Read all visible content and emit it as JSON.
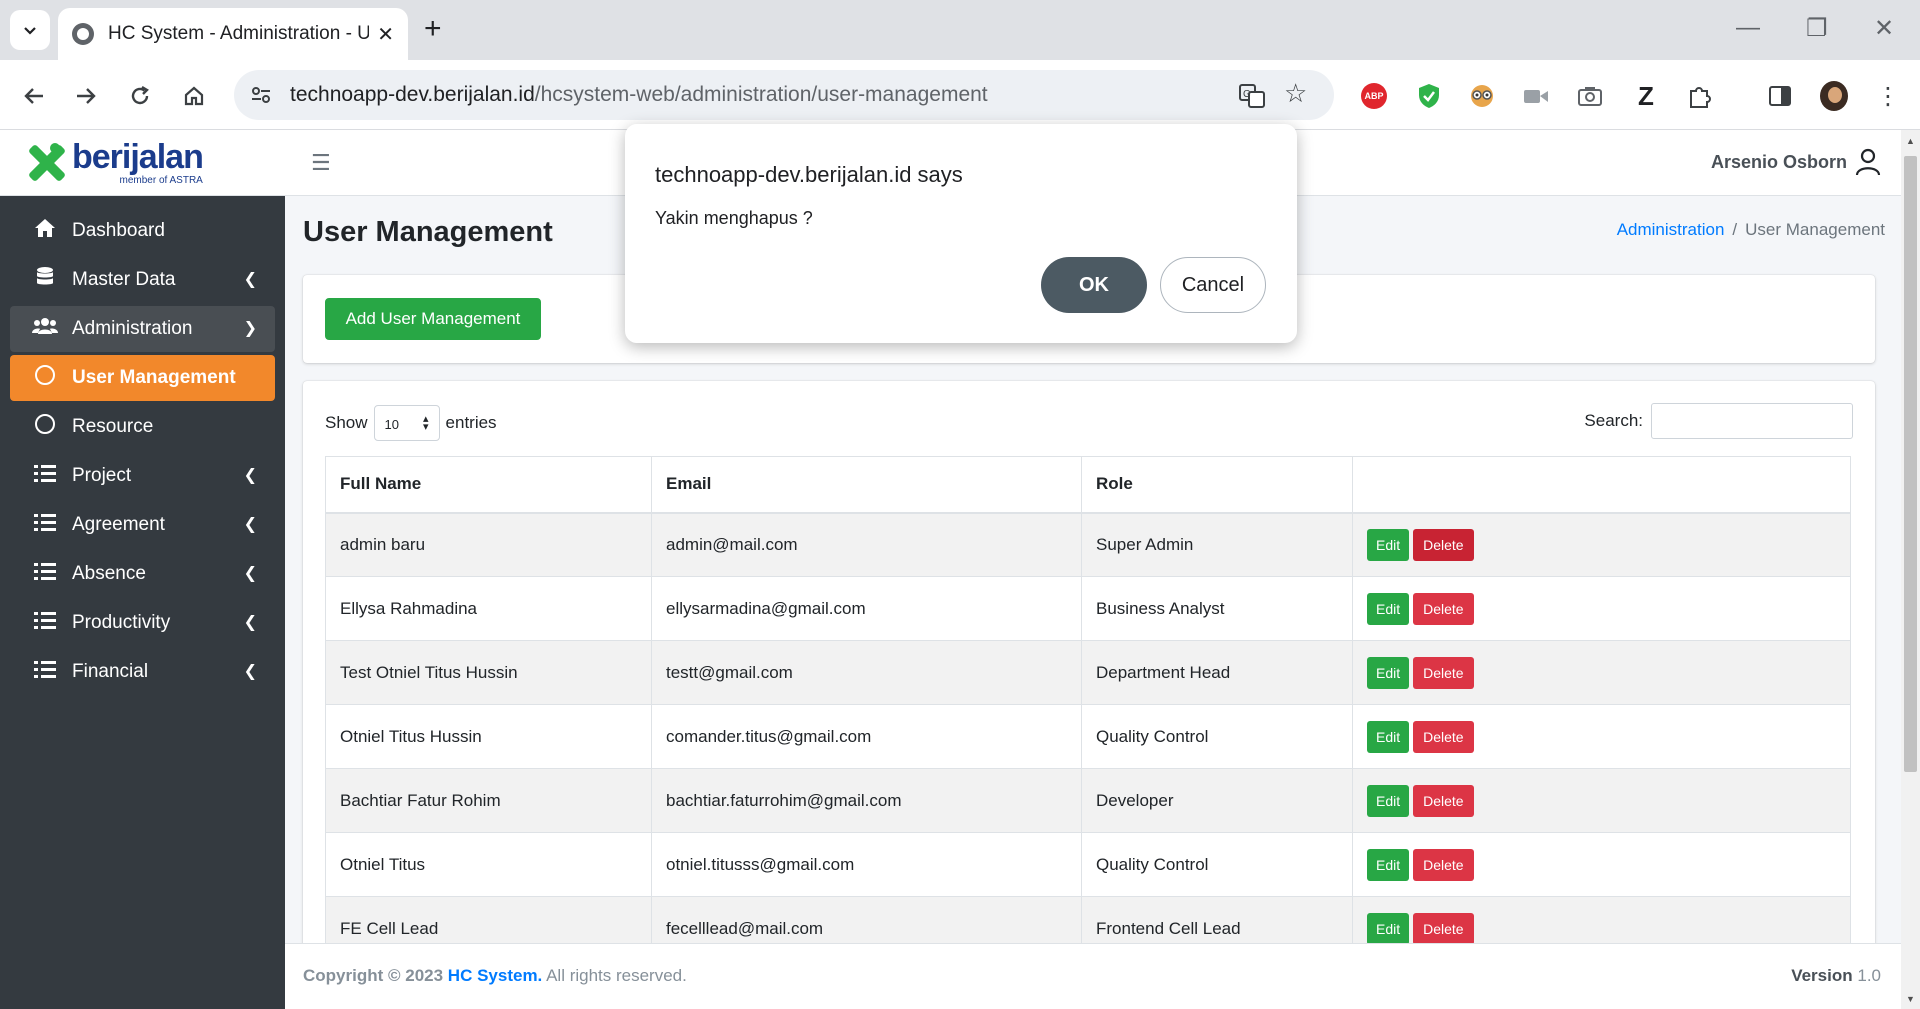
{
  "browser": {
    "tab_title": "HC System - Administration - U",
    "url_host": "technoapp-dev.berijalan.id",
    "url_path": "/hcsystem-web/administration/user-management",
    "abp_label": "ABP",
    "ext_z_label": "Z",
    "icons": [
      "tab-search-icon",
      "globe-icon",
      "close-icon",
      "plus-icon",
      "minimize-icon",
      "restore-icon",
      "back-icon",
      "forward-icon",
      "reload-icon",
      "home-icon",
      "site-info-icon",
      "translate-icon",
      "star-icon",
      "shield-icon",
      "eyes-icon",
      "video-icon",
      "camera-icon",
      "puzzle-icon",
      "sidepanel-icon",
      "menu-dots-icon"
    ]
  },
  "brand": {
    "name": "berijalan",
    "subtitle": "member of ASTRA",
    "color": "#1b3c8c",
    "mark_color": "#2fb34a"
  },
  "sidebar": {
    "items": [
      {
        "label": "Dashboard",
        "icon": "home-icon"
      },
      {
        "label": "Master Data",
        "icon": "database-icon"
      },
      {
        "label": "Administration",
        "icon": "users-icon"
      },
      {
        "label": "User Management",
        "icon": "circle-icon"
      },
      {
        "label": "Resource",
        "icon": "circle-icon"
      },
      {
        "label": "Project",
        "icon": "list-icon"
      },
      {
        "label": "Agreement",
        "icon": "list-icon"
      },
      {
        "label": "Absence",
        "icon": "list-icon"
      },
      {
        "label": "Productivity",
        "icon": "list-icon"
      },
      {
        "label": "Financial",
        "icon": "list-icon"
      }
    ],
    "active_color": "#f2882b"
  },
  "header": {
    "user_name": "Arsenio Osborn"
  },
  "page": {
    "title": "User Management",
    "breadcrumb": {
      "parent": "Administration",
      "current": "User Management",
      "separator": "/"
    },
    "add_button": "Add User Management"
  },
  "table": {
    "show_label": "Show",
    "entries_value": "10",
    "entries_label": "entries",
    "search_label": "Search:",
    "columns": [
      "Full Name",
      "Email",
      "Role",
      ""
    ],
    "edit_label": "Edit",
    "delete_label": "Delete",
    "rows": [
      {
        "name": "admin baru",
        "email": "admin@mail.com",
        "role": "Super Admin"
      },
      {
        "name": "Ellysa Rahmadina",
        "email": "ellysarmadina@gmail.com",
        "role": "Business Analyst"
      },
      {
        "name": "Test Otniel Titus Hussin",
        "email": "testt@gmail.com",
        "role": "Department Head"
      },
      {
        "name": "Otniel Titus Hussin",
        "email": "comander.titus@gmail.com",
        "role": "Quality Control"
      },
      {
        "name": "Bachtiar Fatur Rohim",
        "email": "bachtiar.faturrohim@gmail.com",
        "role": "Developer"
      },
      {
        "name": "Otniel Titus",
        "email": "otniel.titusss@gmail.com",
        "role": "Quality Control"
      },
      {
        "name": "FE Cell Lead",
        "email": "fecelllead@mail.com",
        "role": "Frontend Cell Lead"
      }
    ]
  },
  "footer": {
    "copyright": "Copyright © 2023",
    "brand_link": "HC System.",
    "rights": "All rights reserved.",
    "version_label": "Version",
    "version_value": "1.0"
  },
  "dialog": {
    "title": "technoapp-dev.berijalan.id says",
    "message": "Yakin menghapus ?",
    "ok_label": "OK",
    "cancel_label": "Cancel"
  }
}
